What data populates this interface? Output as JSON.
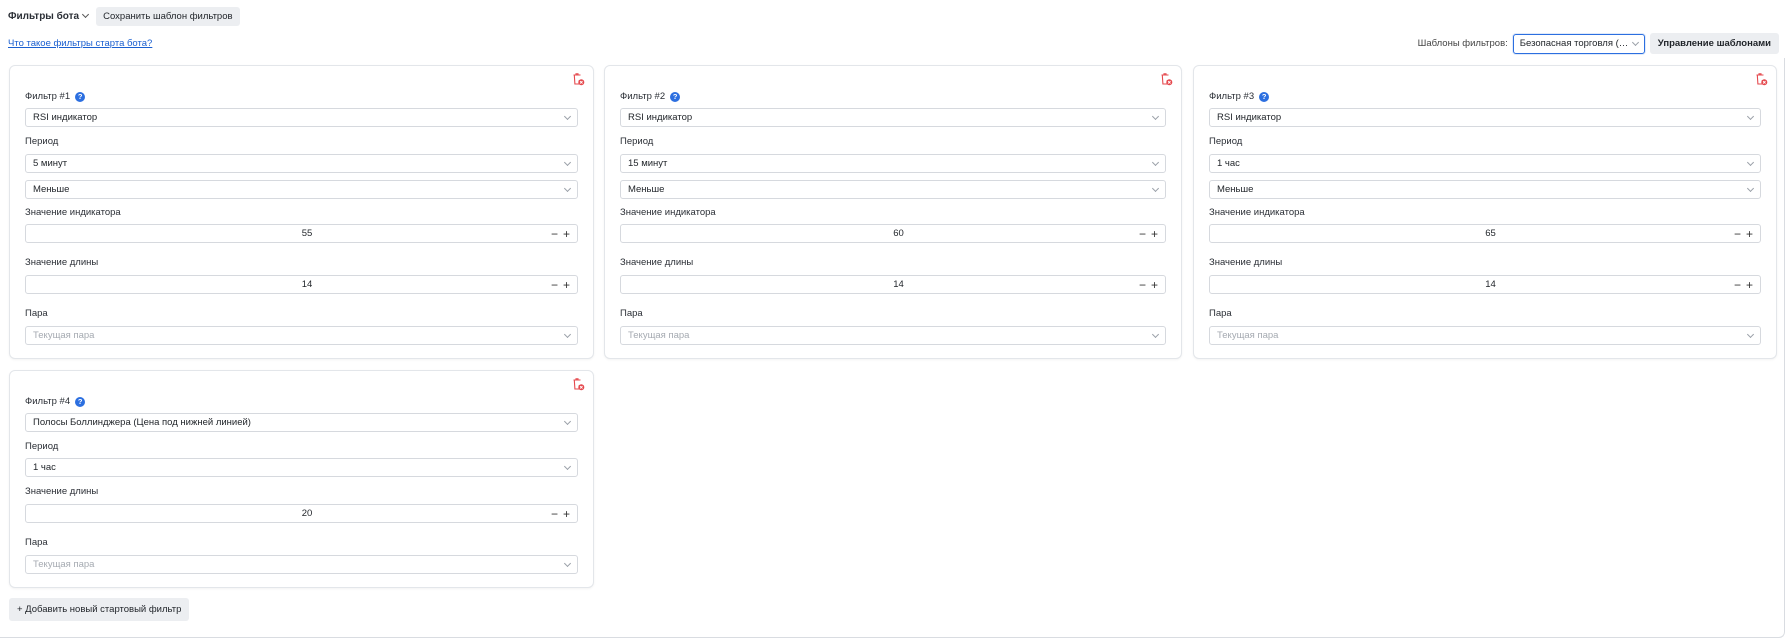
{
  "header": {
    "section_title": "Фильтры бота",
    "save_template_label": "Сохранить шаблон фильтров",
    "help_link": "Что такое фильтры старта бота?",
    "templates_label": "Шаблоны фильтров:",
    "template_selected": "Безопасная торговля (lo...",
    "manage_templates_label": "Управление шаблонами"
  },
  "labels": {
    "period": "Период",
    "indicator_value": "Значение индикатора",
    "length_value": "Значение длины",
    "pair": "Пара",
    "pair_placeholder": "Текущая пара",
    "minus": "−",
    "plus": "+",
    "info": "?"
  },
  "filters": [
    {
      "title": "Фильтр #1",
      "indicator": "RSI индикатор",
      "period": "5 минут",
      "comparison": "Меньше",
      "indicator_value": "55",
      "length_value": "14"
    },
    {
      "title": "Фильтр #2",
      "indicator": "RSI индикатор",
      "period": "15 минут",
      "comparison": "Меньше",
      "indicator_value": "60",
      "length_value": "14"
    },
    {
      "title": "Фильтр #3",
      "indicator": "RSI индикатор",
      "period": "1 час",
      "comparison": "Меньше",
      "indicator_value": "65",
      "length_value": "14"
    },
    {
      "title": "Фильтр #4",
      "indicator": "Полосы Боллинджера (Цена под нижней линией)",
      "period": "1 час",
      "length_value": "20"
    }
  ],
  "add_filter_label": "+ Добавить новый стартовый фильтр",
  "colors": {
    "accent": "#2c6fe0",
    "danger": "#e5484d",
    "link": "#1a5fd0"
  }
}
